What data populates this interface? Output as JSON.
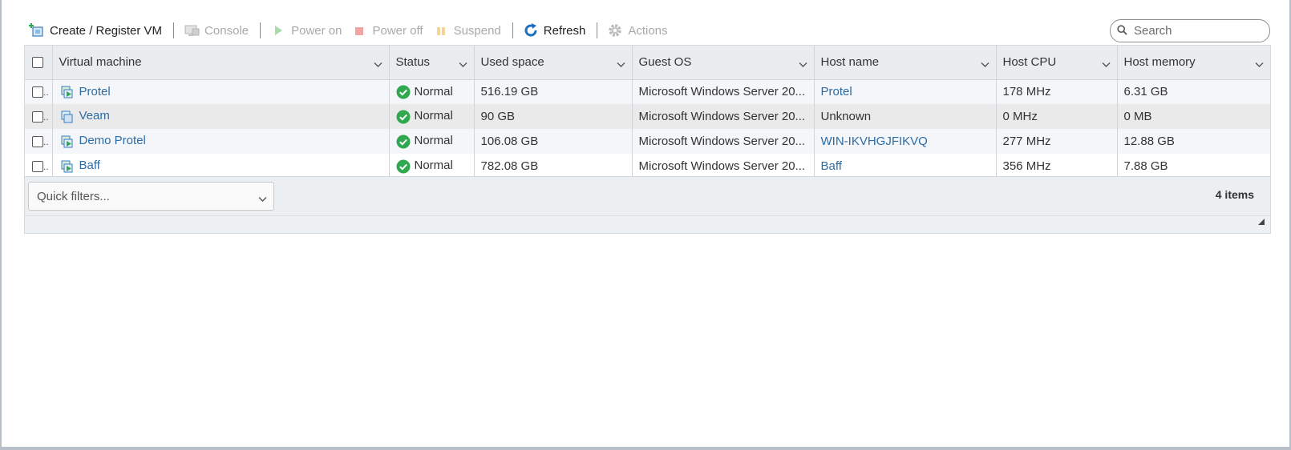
{
  "toolbar": {
    "create_label": "Create / Register VM",
    "console_label": "Console",
    "power_on_label": "Power on",
    "power_off_label": "Power off",
    "suspend_label": "Suspend",
    "refresh_label": "Refresh",
    "actions_label": "Actions"
  },
  "search": {
    "placeholder": "Search"
  },
  "columns": [
    "Virtual machine",
    "Status",
    "Used space",
    "Guest OS",
    "Host name",
    "Host CPU",
    "Host memory"
  ],
  "rows": [
    {
      "name": "Protel",
      "status": "Normal",
      "used_space": "516.19 GB",
      "guest_os": "Microsoft Windows Server 20...",
      "host_name": "Protel",
      "host_cpu": "178 MHz",
      "host_memory": "6.31 GB"
    },
    {
      "name": "Veam",
      "status": "Normal",
      "used_space": "90 GB",
      "guest_os": "Microsoft Windows Server 20...",
      "host_name": "Unknown",
      "host_cpu": "0 MHz",
      "host_memory": "0 MB"
    },
    {
      "name": "Demo Protel",
      "status": "Normal",
      "used_space": "106.08 GB",
      "guest_os": "Microsoft Windows Server 20...",
      "host_name": "WIN-IKVHGJFIKVQ",
      "host_cpu": "277 MHz",
      "host_memory": "12.88 GB"
    },
    {
      "name": "Baff",
      "status": "Normal",
      "used_space": "782.08 GB",
      "guest_os": "Microsoft Windows Server 20...",
      "host_name": "Baff",
      "host_cpu": "356 MHz",
      "host_memory": "7.88 GB"
    }
  ],
  "footer": {
    "quick_filters": "Quick filters...",
    "item_count": "4 items"
  },
  "colors": {
    "link": "#2e6ca4",
    "status_ok": "#2fa84f",
    "header_bg": "#e9edf0"
  }
}
